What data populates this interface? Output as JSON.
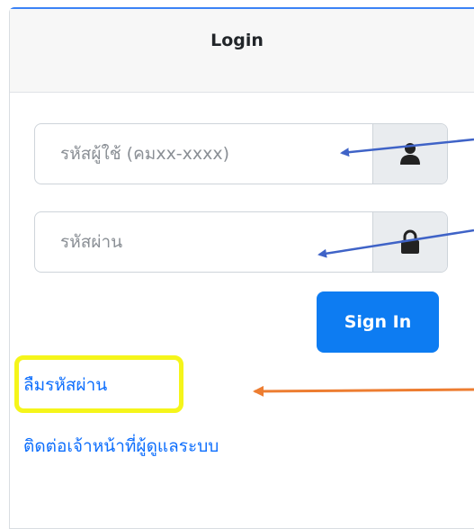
{
  "login": {
    "title": "Login",
    "username_placeholder": "รหัสผู้ใช้ (คมxx-xxxx)",
    "password_placeholder": "รหัสผ่าน",
    "signin_label": "Sign In",
    "forgot_password_label": "ลืมรหัสผ่าน",
    "contact_admin_label": "ติดต่อเจ้าหน้าที่ผู้ดูแลระบบ",
    "username_icon": "user-icon",
    "password_icon": "lock-icon"
  },
  "colors": {
    "primary": "#0d7cf2",
    "link": "#0d6efd",
    "highlight": "#f5f51a",
    "arrow_blue": "#3f63c7",
    "arrow_orange": "#ed7d31"
  }
}
